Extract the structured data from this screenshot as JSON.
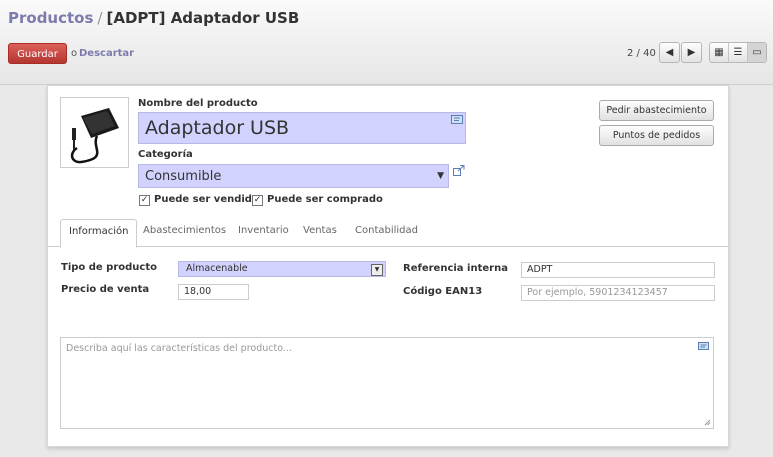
{
  "breadcrumb": {
    "parent": "Productos",
    "separator": "/",
    "current": "[ADPT] Adaptador USB"
  },
  "toolbar": {
    "save_label": "Guardar",
    "or_label": "o",
    "discard_label": "Descartar"
  },
  "pager": {
    "label": "2 / 40",
    "prev_icon": "arrow-left-icon",
    "next_icon": "arrow-right-icon"
  },
  "view_switcher": {
    "views": [
      "kanban-icon",
      "list-icon",
      "form-icon"
    ],
    "active": "form-icon"
  },
  "form": {
    "name_label": "Nombre del producto",
    "name_value": "Adaptador USB",
    "category_label": "Categoría",
    "category_value": "Consumible",
    "sale_ok_label": "Puede ser vendido",
    "purchase_ok_label": "Puede ser comprado",
    "sale_ok_checked": true,
    "purchase_ok_checked": true,
    "buttons": {
      "procurement": "Pedir abastecimiento",
      "orderpoints": "Puntos de pedidos"
    },
    "image_icon": "usb-adapter-photo"
  },
  "tabs": [
    "Información",
    "Abastecimientos",
    "Inventario",
    "Ventas",
    "Contabilidad"
  ],
  "active_tab": "Información",
  "info": {
    "type_label": "Tipo de producto",
    "type_value": "Almacenable",
    "price_label": "Precio de venta",
    "price_value": "18,00",
    "ref_label": "Referencia interna",
    "ref_value": "ADPT",
    "ean_label": "Código EAN13",
    "ean_placeholder": "Por ejemplo, 5901234123457",
    "description_placeholder": "Describa aquí las características del producto..."
  },
  "colors": {
    "accent": "#7c7bad",
    "save": "#c33c36",
    "required": "#d2d2ff"
  }
}
